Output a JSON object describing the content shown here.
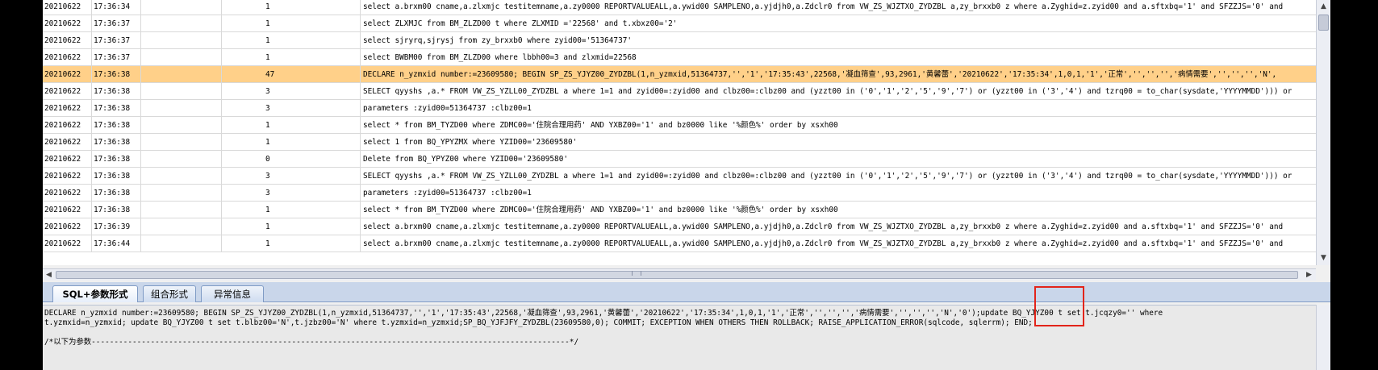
{
  "grid": {
    "rows": [
      {
        "date": "20210622",
        "time": "17:36:34",
        "dur": "1",
        "sql": "select a.brxm00 cname,a.zlxmjc testitemname,a.zy0000 REPORTVALUEALL,a.ywid00 SAMPLENO,a.yjdjh0,a.Zdclr0   from VW_ZS_WJZTXO_ZYDZBL a,zy_brxxb0 z  where a.Zyghid=z.zyid00 and a.sftxbq='1' and SFZZJS='0' and"
      },
      {
        "date": "20210622",
        "time": "17:36:37",
        "dur": "1",
        "sql": "select ZLXMJC from  BM_ZLZD00 t where  ZLXMID ='22568'   and t.xbxz00='2'"
      },
      {
        "date": "20210622",
        "time": "17:36:37",
        "dur": "1",
        "sql": "select sjryrq,sjrysj from zy_brxxb0 where zyid00='51364737'"
      },
      {
        "date": "20210622",
        "time": "17:36:37",
        "dur": "1",
        "sql": "select BWBM00 from BM_ZLZD00 where lbbh00=3 and zlxmid=22568"
      },
      {
        "date": "20210622",
        "time": "17:36:38",
        "dur": "47",
        "sql": "DECLARE n_yzmxid number:=23609580; BEGIN SP_ZS_YJYZ00_ZYDZBL(1,n_yzmxid,51364737,'','1','17:35:43',22568,'凝血筛查',93,2961,'黄馨蕾','20210622','17:35:34',1,0,1,'1','正常','','','','病情需要','','','','N',",
        "selected": true
      },
      {
        "date": "20210622",
        "time": "17:36:38",
        "dur": "3",
        "sql": "SELECT qyyshs ,a.* FROM VW_ZS_YZLL00_ZYDZBL a  where 1=1 and zyid00=:zyid00 and clbz00=:clbz00 and (yzzt00 in ('0','1','2','5','9','7') or (yzzt00 in ('3','4') and tzrq00 = to_char(sysdate,'YYYYMMDD')))  or"
      },
      {
        "date": "20210622",
        "time": "17:36:38",
        "dur": "3",
        "sql": "parameters :zyid00=51364737 :clbz00=1"
      },
      {
        "date": "20210622",
        "time": "17:36:38",
        "dur": "1",
        "sql": "select * from BM_TYZD00 where ZDMC00='住院合理用药' AND YXBZ00='1' and bz0000 like '%颜色%' order by xsxh00"
      },
      {
        "date": "20210622",
        "time": "17:36:38",
        "dur": "1",
        "sql": "select 1 from BQ_YPYZMX where YZID00='23609580'"
      },
      {
        "date": "20210622",
        "time": "17:36:38",
        "dur": "0",
        "sql": "Delete from BQ_YPYZ00 where YZID00='23609580'"
      },
      {
        "date": "20210622",
        "time": "17:36:38",
        "dur": "3",
        "sql": "SELECT qyyshs ,a.* FROM VW_ZS_YZLL00_ZYDZBL a  where 1=1 and zyid00=:zyid00 and clbz00=:clbz00 and (yzzt00 in ('0','1','2','5','9','7') or (yzzt00 in ('3','4') and tzrq00 = to_char(sysdate,'YYYYMMDD')))  or"
      },
      {
        "date": "20210622",
        "time": "17:36:38",
        "dur": "3",
        "sql": "parameters :zyid00=51364737 :clbz00=1"
      },
      {
        "date": "20210622",
        "time": "17:36:38",
        "dur": "1",
        "sql": "select * from BM_TYZD00 where ZDMC00='住院合理用药' AND YXBZ00='1' and bz0000 like '%颜色%' order by xsxh00"
      },
      {
        "date": "20210622",
        "time": "17:36:39",
        "dur": "1",
        "sql": "select a.brxm00 cname,a.zlxmjc testitemname,a.zy0000 REPORTVALUEALL,a.ywid00 SAMPLENO,a.yjdjh0,a.Zdclr0   from VW_ZS_WJZTXO_ZYDZBL a,zy_brxxb0 z  where a.Zyghid=z.zyid00 and a.sftxbq='1' and SFZZJS='0' and"
      },
      {
        "date": "20210622",
        "time": "17:36:44",
        "dur": "1",
        "sql": "select a.brxm00 cname,a.zlxmjc testitemname,a.zy0000 REPORTVALUEALL,a.ywid00 SAMPLENO,a.yjdjh0,a.Zdclr0   from VW_ZS_WJZTXO_ZYDZBL a,zy_brxxb0 z  where a.Zyghid=z.zyid00 and a.sftxbq='1' and SFZZJS='0' and"
      }
    ]
  },
  "tabs": {
    "sql_params": "SQL+参数形式",
    "combined": "组合形式",
    "exception": "异常信息"
  },
  "detail": {
    "line1": "DECLARE n_yzmxid number:=23609580; BEGIN SP_ZS_YJYZ00_ZYDZBL(1,n_yzmxid,51364737,'','1','17:35:43',22568,'凝血筛查',93,2961,'黄馨蕾','20210622','17:35:34',1,0,1,'1','正常','','','','病情需要','','','','N','0');update BQ_YJYZ00 t set t.jcqzy0='' where",
    "line2": "t.yzmxid=n_yzmxid; update BQ_YJYZ00 t set t.blbz00='N',t.jzbz00='N' where t.yzmxid=n_yzmxid;SP_BQ_YJFJFY_ZYDZBL(23609580,0); COMMIT; EXCEPTION WHEN OTHERS THEN ROLLBACK; RAISE_APPLICATION_ERROR(sqlcode, sqlerrm); END;",
    "line3": "/*以下为参数---------------------------------------------------------------------------------------------------------*/"
  },
  "colors": {
    "selected_row": "#ffd089",
    "annotation": "#e2241a"
  }
}
